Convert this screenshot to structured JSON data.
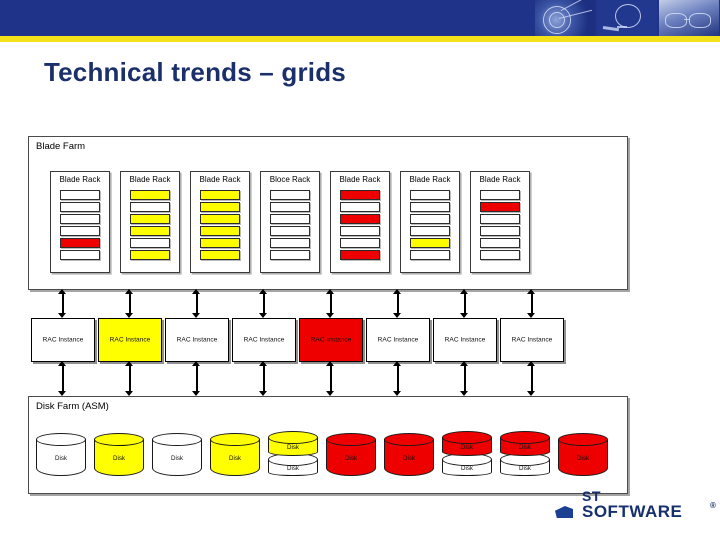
{
  "slide": {
    "title": "Technical trends – grids",
    "title_color": "#1b2f6b",
    "header_band_color": "#1f3388",
    "header_rule_color": "#f4e11a",
    "background": "#ffffff"
  },
  "header": {
    "images": [
      {
        "name": "abstract-machinery-image"
      },
      {
        "name": "lightbulb-image"
      },
      {
        "name": "person-with-glasses-image"
      }
    ]
  },
  "colors": {
    "white": "#ffffff",
    "yellow": "#ffff00",
    "red": "#ee0000",
    "outline": "#2b2b2b"
  },
  "blade_farm": {
    "label": "Blade Farm",
    "racks": [
      {
        "title": "Blade Rack",
        "blades": [
          "white",
          "white",
          "white",
          "white",
          "red",
          "white"
        ]
      },
      {
        "title": "Blade Rack",
        "blades": [
          "yellow",
          "white",
          "yellow",
          "yellow",
          "white",
          "yellow"
        ]
      },
      {
        "title": "Blade Rack",
        "blades": [
          "yellow",
          "yellow",
          "yellow",
          "yellow",
          "yellow",
          "yellow"
        ]
      },
      {
        "title": "Bloce Rack",
        "blades": [
          "white",
          "white",
          "white",
          "white",
          "white",
          "white"
        ]
      },
      {
        "title": "Blade Rack",
        "blades": [
          "red",
          "white",
          "red",
          "white",
          "white",
          "red"
        ]
      },
      {
        "title": "Blade Rack",
        "blades": [
          "white",
          "white",
          "white",
          "white",
          "yellow",
          "white"
        ]
      },
      {
        "title": "Blade Rack",
        "blades": [
          "white",
          "red",
          "white",
          "white",
          "white",
          "white"
        ]
      }
    ]
  },
  "rac_layer": {
    "instances": [
      {
        "label": "RAC Instance",
        "color": "white"
      },
      {
        "label": "RAC Instance",
        "color": "yellow"
      },
      {
        "label": "RAC Instance",
        "color": "white"
      },
      {
        "label": "RAC Instance",
        "color": "white"
      },
      {
        "label": "RAC Instance",
        "color": "red"
      },
      {
        "label": "RAC Instance",
        "color": "white"
      },
      {
        "label": "RAC Instance",
        "color": "white"
      },
      {
        "label": "RAC Instance",
        "color": "white"
      }
    ]
  },
  "disk_farm": {
    "label": "Disk Farm (ASM)",
    "disks": [
      {
        "kind": "single",
        "top": {
          "label": "Disk",
          "color": "white"
        }
      },
      {
        "kind": "single",
        "top": {
          "label": "Disk",
          "color": "yellow"
        }
      },
      {
        "kind": "single",
        "top": {
          "label": "Disk",
          "color": "white"
        }
      },
      {
        "kind": "single",
        "top": {
          "label": "Disk",
          "color": "yellow"
        }
      },
      {
        "kind": "stacked",
        "top": {
          "label": "Disk",
          "color": "yellow"
        },
        "bottom": {
          "label": "Disk",
          "color": "white"
        }
      },
      {
        "kind": "single",
        "top": {
          "label": "Disk",
          "color": "red"
        }
      },
      {
        "kind": "single",
        "top": {
          "label": "Disk",
          "color": "red"
        }
      },
      {
        "kind": "stacked",
        "top": {
          "label": "Disk",
          "color": "red"
        },
        "bottom": {
          "label": "Disk",
          "color": "white"
        }
      },
      {
        "kind": "stacked",
        "top": {
          "label": "Disk",
          "color": "red"
        },
        "bottom": {
          "label": "Disk",
          "color": "white"
        }
      },
      {
        "kind": "single",
        "top": {
          "label": "Disk",
          "color": "red"
        }
      }
    ]
  },
  "connectors": {
    "upper_count": 8,
    "lower_count": 8,
    "style": "double-headed-vertical-arrow"
  },
  "footer_logo": {
    "top_text": "ST",
    "bottom_text": "SOFTWARE",
    "trademark": "®"
  }
}
